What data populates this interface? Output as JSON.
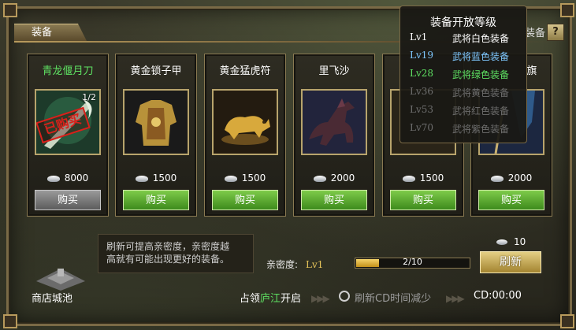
{
  "panel": {
    "tab_label": "装备",
    "tab_right_label": "装备",
    "help_label": "?"
  },
  "items": [
    {
      "name": "青龙偃月刀",
      "count": "1/2",
      "stamp": "已购买",
      "price": "8000",
      "button": "购买",
      "title_color": "green",
      "button_state": "disabled"
    },
    {
      "name": "黄金锁子甲",
      "price": "1500",
      "button": "购买"
    },
    {
      "name": "黄金猛虎符",
      "price": "1500",
      "button": "购买"
    },
    {
      "name": "里飞沙",
      "price": "2000",
      "button": "购买"
    },
    {
      "name": "",
      "price": "1500",
      "button": "购买"
    },
    {
      "name": "旗",
      "price": "2000",
      "button": "购买"
    }
  ],
  "level_popup": {
    "title": "装备开放等级",
    "rows": [
      {
        "level": "Lv1",
        "text": "武将白色装备",
        "color": "#ffffff"
      },
      {
        "level": "Lv19",
        "text": "武将蓝色装备",
        "color": "#7fc8ff"
      },
      {
        "level": "Lv28",
        "text": "武将绿色装备",
        "color": "#5ee062"
      },
      {
        "level": "Lv36",
        "text": "武将黄色装备",
        "color": "#6e6e6e"
      },
      {
        "level": "Lv53",
        "text": "武将红色装备",
        "color": "#6e6e6e"
      },
      {
        "level": "Lv70",
        "text": "武将紫色装备",
        "color": "#6e6e6e"
      }
    ]
  },
  "info_box": {
    "line1": "刷新可提高亲密度，亲密度越",
    "line2": "高就有可能出现更好的装备。"
  },
  "intimacy": {
    "label": "亲密度:",
    "level": "Lv1",
    "progress_text": "2/10",
    "progress_fraction": 0.2
  },
  "refresh": {
    "cost": "10",
    "button": "刷新"
  },
  "footer": {
    "shop_label": "商店城池",
    "unlock_prefix": "占领",
    "unlock_city": "庐江",
    "unlock_suffix": "开启",
    "reduce_cd_label": "刷新CD时间减少",
    "cd_label": "CD:00:00"
  },
  "colors": {
    "accent_gold": "#b89a5c",
    "buy_green": "#3d8a1c",
    "highlight_green": "#5ee062"
  }
}
